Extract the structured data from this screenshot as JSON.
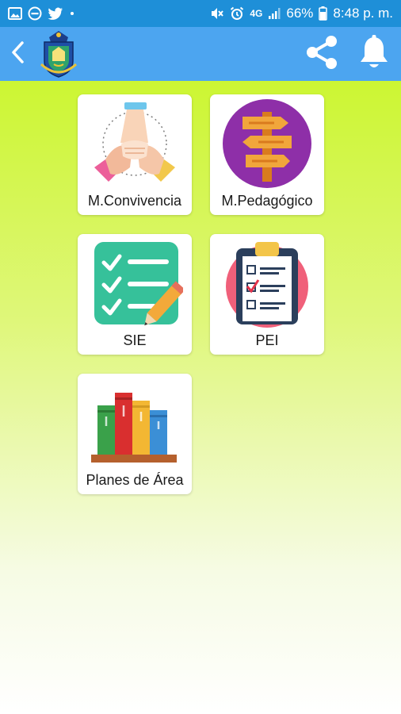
{
  "status_bar": {
    "battery": "66%",
    "time": "8:48 p. m.",
    "network": "4G",
    "left_icons": [
      "image-icon",
      "do-not-disturb-icon",
      "twitter-icon",
      "dot-icon"
    ],
    "right_icons": [
      "mute-icon",
      "alarm-icon",
      "network-icon",
      "signal-icon",
      "battery-icon"
    ]
  },
  "app_bar": {
    "back_icon": "chevron-left-icon",
    "logo": "school-crest-logo",
    "actions": [
      "share-icon",
      "bell-icon"
    ]
  },
  "menu": {
    "items": [
      {
        "label": "M.Convivencia",
        "icon": "hands-together-icon"
      },
      {
        "label": "M.Pedagógico",
        "icon": "signpost-icon"
      },
      {
        "label": "SIE",
        "icon": "checklist-pencil-icon"
      },
      {
        "label": "PEI",
        "icon": "clipboard-checklist-icon"
      },
      {
        "label": "Planes de Área",
        "icon": "books-icon"
      }
    ]
  },
  "colors": {
    "status_bar": "#1e8fd8",
    "app_bar": "#4ca5f0",
    "background_top": "#c6f51a",
    "background_bottom": "#ffffff"
  }
}
